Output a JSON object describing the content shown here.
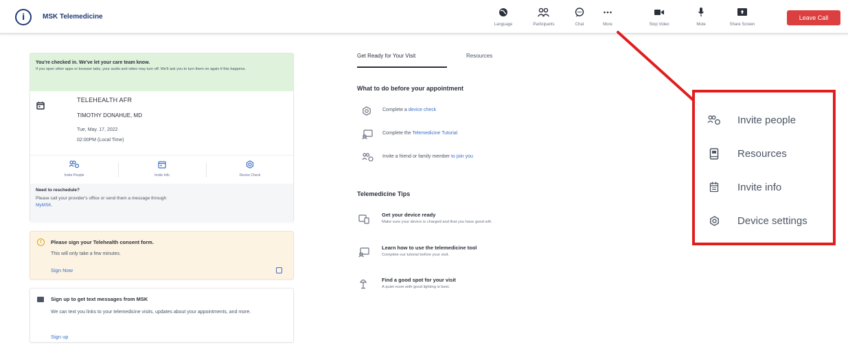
{
  "header": {
    "app_title": "MSK Telemedicine",
    "logo_icon": "msk-logo-icon",
    "toolbar": [
      {
        "key": "language",
        "label": "Language",
        "icon": "globe-icon"
      },
      {
        "key": "participants",
        "label": "Participants",
        "icon": "people-icon"
      },
      {
        "key": "chat",
        "label": "Chat",
        "icon": "chat-bubble-icon"
      },
      {
        "key": "more",
        "label": "More",
        "icon": "more-dots-icon"
      },
      {
        "key": "stop_video",
        "label": "Stop Video",
        "icon": "video-camera-icon"
      },
      {
        "key": "mute",
        "label": "Mute",
        "icon": "microphone-icon"
      },
      {
        "key": "share_screen",
        "label": "Share Screen",
        "icon": "share-screen-icon"
      }
    ],
    "leave_call_label": "Leave Call"
  },
  "checkin_card": {
    "banner_title": "You're checked in. We've let your care team know.",
    "banner_text": "If you open other apps or browser tabs, your audio and video may turn off. We'll ask you to turn them on again if this happens.",
    "appointment_name": "TELEHEALTH AFR",
    "doctor": "TIMOTHY DONAHUE, MD",
    "date": "Tue, May. 17, 2022",
    "time": "02:00PM (Local Time)",
    "actions": [
      {
        "label": "Invite People",
        "icon": "invite-people-icon"
      },
      {
        "label": "Invite Info",
        "icon": "invite-info-icon"
      },
      {
        "label": "Device Check",
        "icon": "device-check-icon"
      }
    ],
    "reschedule_title": "Need to reschedule?",
    "reschedule_text": "Please call your provider's office or send them a message through",
    "reschedule_link": "MyMSK."
  },
  "consent_card": {
    "title": "Please sign your Telehealth consent form.",
    "text": "This will only take a few minutes.",
    "link": "Sign Now"
  },
  "sms_card": {
    "title": "Sign up to get text messages from MSK",
    "text": "We can text you links to your telemedicine visits, updates about your appointments, and more.",
    "link": "Sign up"
  },
  "main": {
    "tabs": [
      {
        "label": "Get Ready for Your Visit",
        "active": true
      },
      {
        "label": "Resources",
        "active": false
      }
    ],
    "todo_title": "What to do before your appointment",
    "todos": [
      {
        "prefix": "Complete a ",
        "link": "device check",
        "icon": "gear-icon"
      },
      {
        "prefix": "Complete the ",
        "link": "Telemedicine Tutorial",
        "icon": "tutorial-icon"
      },
      {
        "prefix": "Invite a friend or family member ",
        "link": "to join you",
        "icon": "invite-people-icon"
      }
    ],
    "tips_title": "Telemedicine Tips",
    "tips": [
      {
        "title": "Get your device ready",
        "text": "Make sure your device is charged and that you have good wifi.",
        "icon": "devices-icon"
      },
      {
        "title": "Learn how to use the telemedicine tool",
        "text": "Complete our tutorial before your visit.",
        "icon": "tutorial-icon"
      },
      {
        "title": "Find a good spot for your visit",
        "text": "A quiet room with good lighting is best.",
        "icon": "lamp-icon"
      }
    ]
  },
  "more_menu": {
    "items": [
      {
        "label": "Invite people",
        "icon": "invite-people-icon"
      },
      {
        "label": "Resources",
        "icon": "book-icon"
      },
      {
        "label": "Invite info",
        "icon": "calendar-icon"
      },
      {
        "label": "Device settings",
        "icon": "gear-icon"
      }
    ]
  },
  "colors": {
    "brand": "#1f3a73",
    "leave_call": "#dc3f3f",
    "link": "#3b6fc4",
    "callout": "#e01e1e",
    "checkin_banner": "#dff2dc",
    "consent_bg": "#fcf3e3"
  }
}
